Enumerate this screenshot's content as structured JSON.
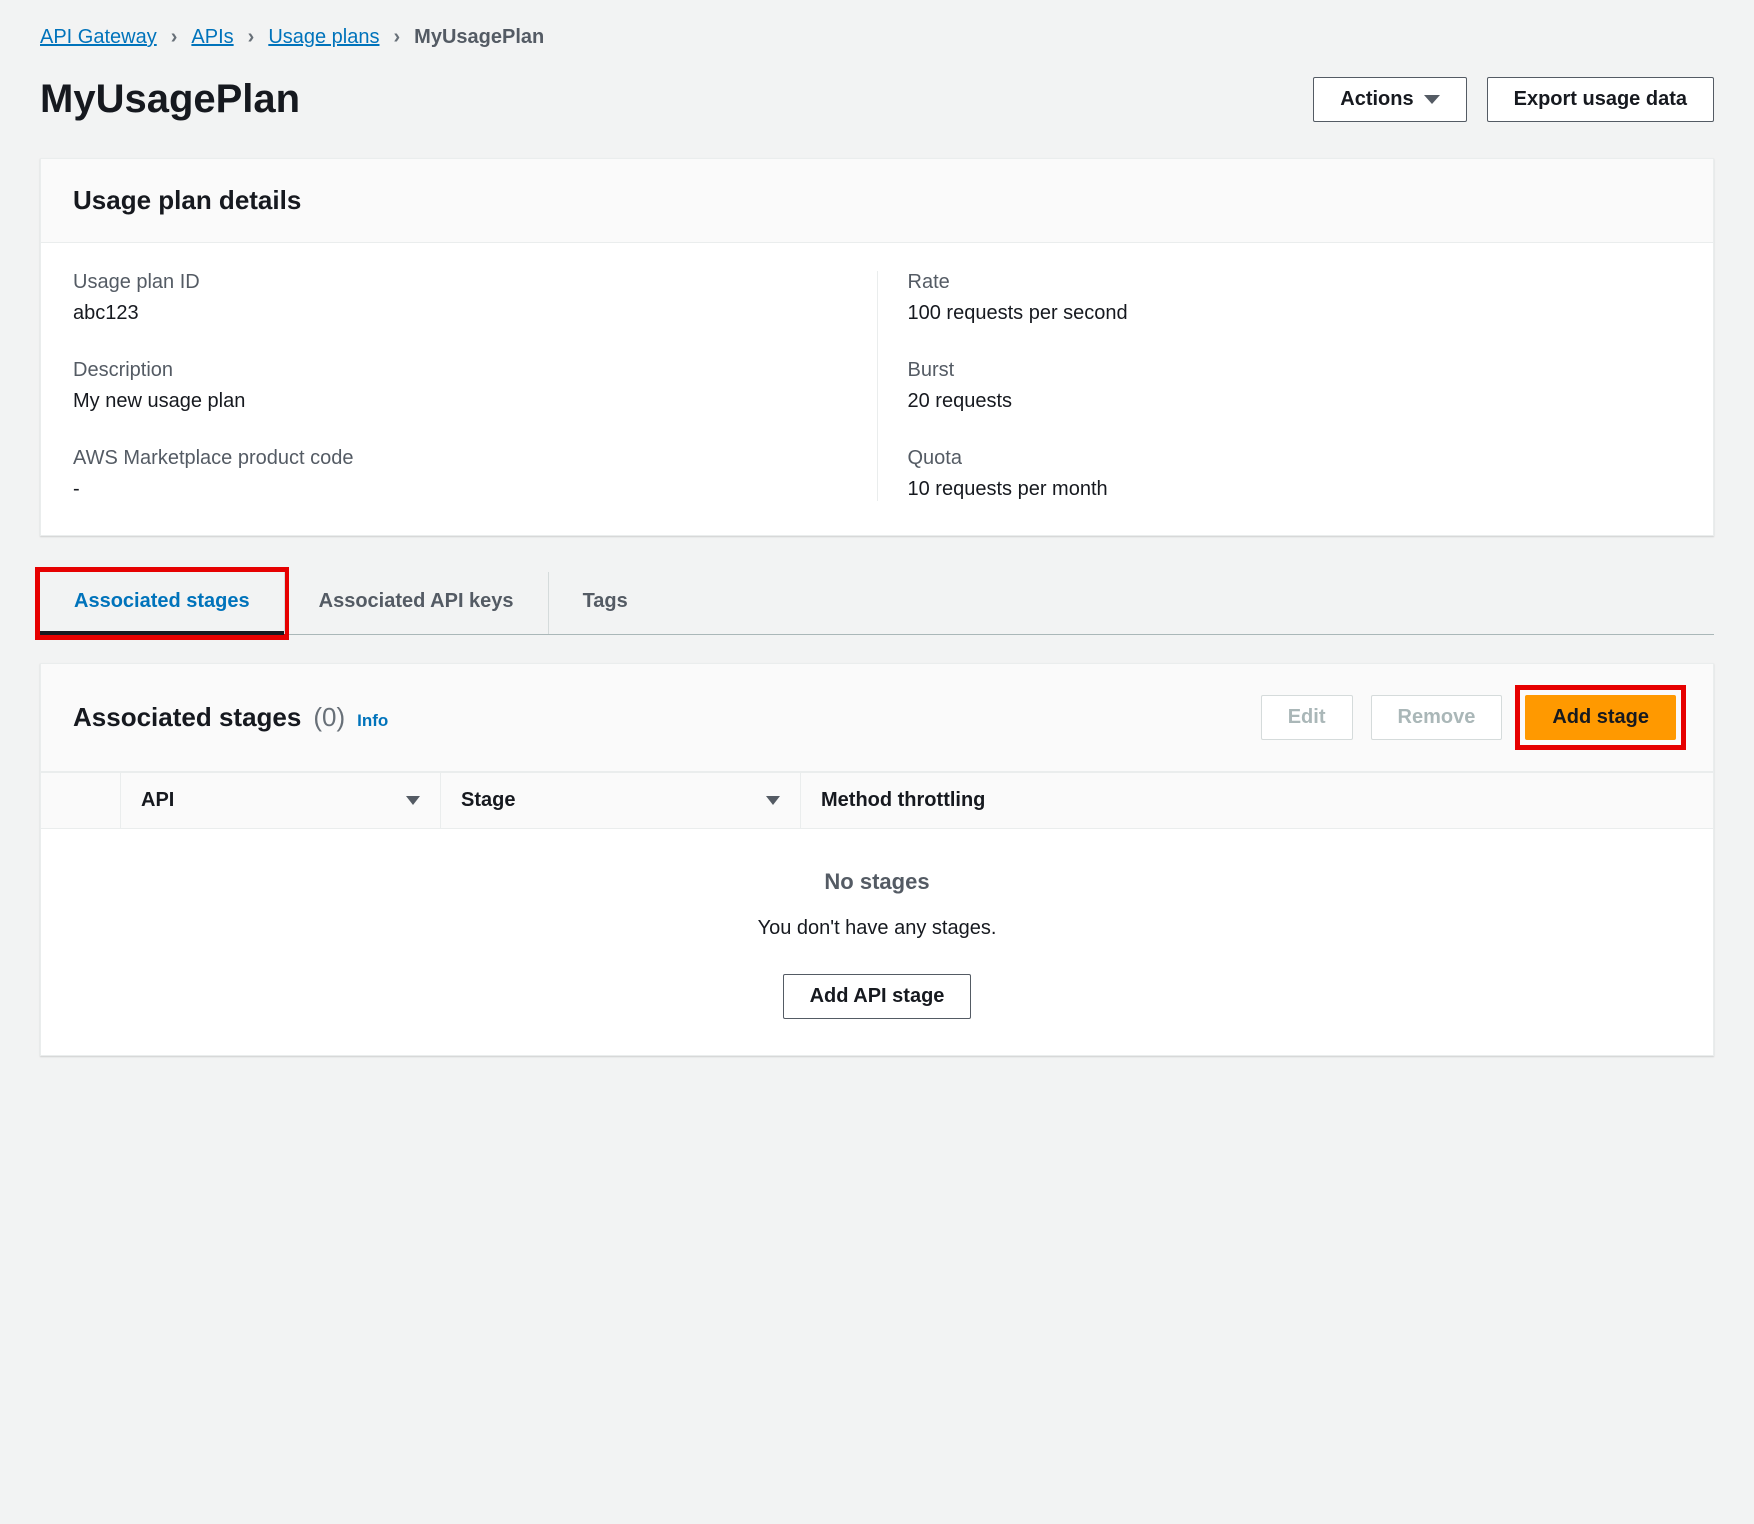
{
  "breadcrumb": {
    "items": [
      {
        "label": "API Gateway"
      },
      {
        "label": "APIs"
      },
      {
        "label": "Usage plans"
      }
    ],
    "current": "MyUsagePlan"
  },
  "page": {
    "title": "MyUsagePlan",
    "actions_label": "Actions",
    "export_label": "Export usage data"
  },
  "details_panel": {
    "title": "Usage plan details",
    "left": [
      {
        "label": "Usage plan ID",
        "value": "abc123"
      },
      {
        "label": "Description",
        "value": "My new usage plan"
      },
      {
        "label": "AWS Marketplace product code",
        "value": "-"
      }
    ],
    "right": [
      {
        "label": "Rate",
        "value": "100 requests per second"
      },
      {
        "label": "Burst",
        "value": "20 requests"
      },
      {
        "label": "Quota",
        "value": "10 requests per month"
      }
    ]
  },
  "tabs": [
    {
      "label": "Associated stages",
      "active": true
    },
    {
      "label": "Associated API keys",
      "active": false
    },
    {
      "label": "Tags",
      "active": false
    }
  ],
  "stages_panel": {
    "title": "Associated stages",
    "count": "(0)",
    "info": "Info",
    "edit_label": "Edit",
    "remove_label": "Remove",
    "add_stage_label": "Add stage",
    "columns": {
      "api": "API",
      "stage": "Stage",
      "method_throttling": "Method throttling"
    },
    "empty": {
      "title": "No stages",
      "subtitle": "You don't have any stages.",
      "cta": "Add API stage"
    }
  }
}
